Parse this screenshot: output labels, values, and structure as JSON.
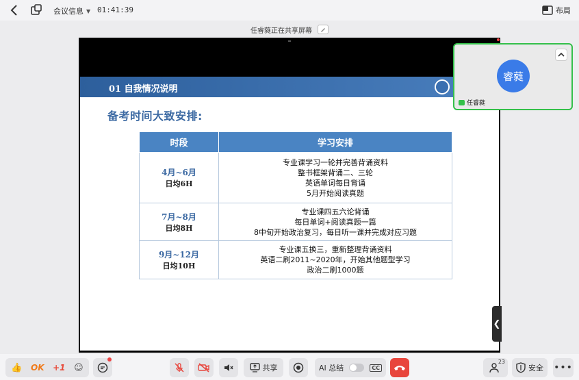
{
  "topbar": {
    "meeting_info": "会议信息",
    "time": "01:41:39",
    "layout_label": "布局"
  },
  "share_notice": "任睿蕤正在共享屏幕",
  "slide": {
    "header_title": "01 自我情况说明",
    "subtitle": "备考时间大致安排:",
    "table": {
      "headers": [
        "时段",
        "学习安排"
      ],
      "rows": [
        {
          "period": "4月~6月",
          "daily": "日均6H",
          "plan": [
            "专业课学习一轮并完善背诵资料",
            "整书框架背诵二、三轮",
            "英语单词每日背诵",
            "5月开始阅读真题"
          ]
        },
        {
          "period": "7月~8月",
          "daily": "日均8H",
          "plan": [
            "专业课四五六论背诵",
            "每日单词+阅读真题一篇",
            "8中旬开始政治复习，每日听一课并完成对应习题"
          ]
        },
        {
          "period": "9月~12月",
          "daily": "日均10H",
          "plan": [
            "专业课五换三，重新整理背诵资料",
            "英语二刷2011~2020年，开始其他题型学习",
            "政治二刷1000题"
          ]
        }
      ]
    }
  },
  "tile": {
    "avatar_text": "睿蕤",
    "name": "任睿蕤"
  },
  "toolbar": {
    "react_ok": "OK",
    "react_plus": "+1",
    "share_label": "共享",
    "ai_label": "AI 总结",
    "cc_label": "CC",
    "member_count": "23",
    "security_label": "安全"
  },
  "colors": {
    "accent_blue": "#3a7be8",
    "slide_header": "#2d5f9c",
    "table_header": "#4a84c3",
    "hangup_red": "#e8453c",
    "speaker_green": "#34c04a"
  }
}
